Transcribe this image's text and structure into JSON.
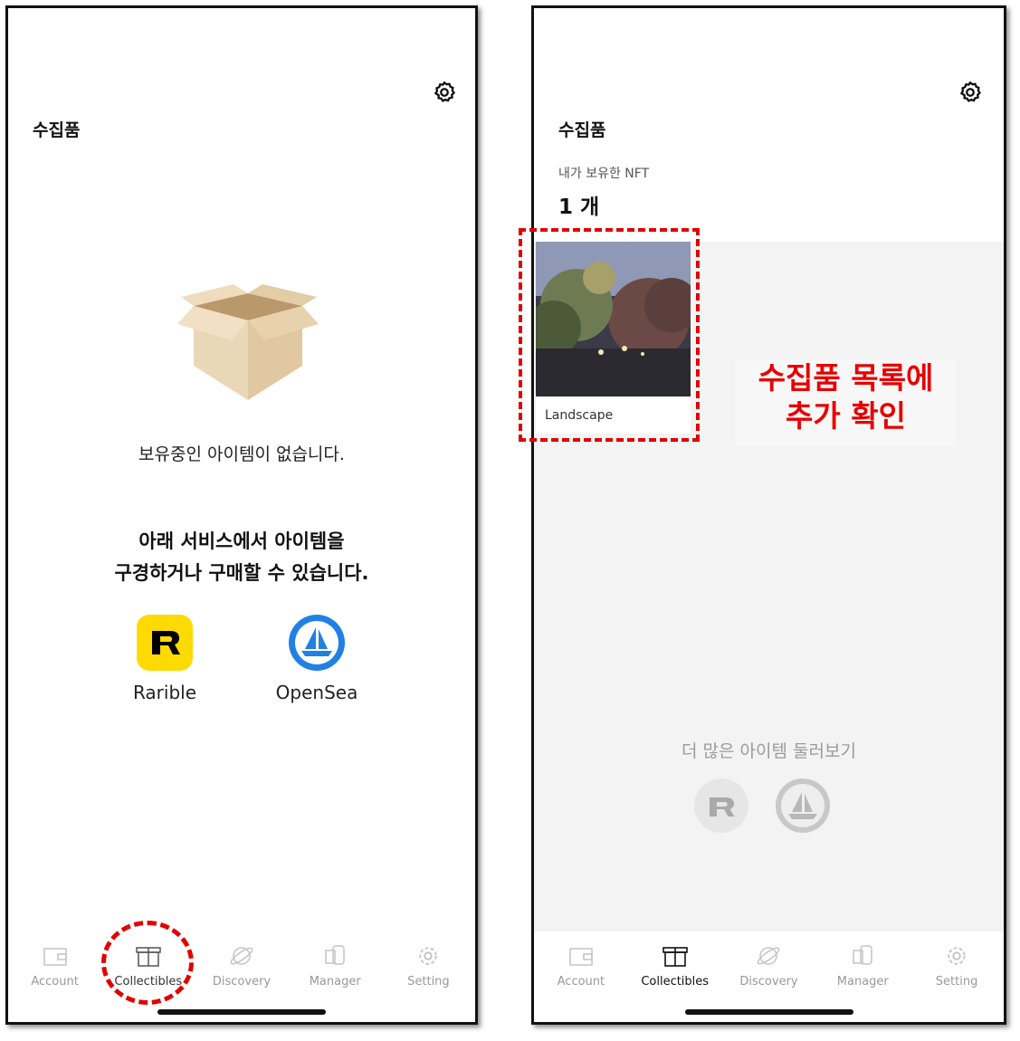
{
  "left_screen": {
    "title": "수집품",
    "empty_message": "보유중인 아이템이 없습니다.",
    "browse_line1": "아래 서비스에서 아이템을",
    "browse_line2": "구경하거나 구매할 수 있습니다.",
    "services": [
      {
        "name": "Rarible",
        "icon": "rarible-logo",
        "color": "#FEDA03"
      },
      {
        "name": "OpenSea",
        "icon": "opensea-logo",
        "color": "#2081E2"
      }
    ]
  },
  "right_screen": {
    "title": "수집품",
    "nft_label": "내가 보유한 NFT",
    "nft_count": "1 개",
    "nfts": [
      {
        "name": "Landscape"
      }
    ],
    "callout_line1": "수집품 목록에",
    "callout_line2": "추가 확인",
    "more_message": "더 많은 아이템 둘러보기"
  },
  "tabs": [
    {
      "label": "Account",
      "icon": "wallet-icon"
    },
    {
      "label": "Collectibles",
      "icon": "gift-box-icon"
    },
    {
      "label": "Discovery",
      "icon": "planet-icon"
    },
    {
      "label": "Manager",
      "icon": "manager-icon"
    },
    {
      "label": "Setting",
      "icon": "gear-icon"
    }
  ],
  "active_tab": "Collectibles",
  "colors": {
    "highlight": "#E10000",
    "inactive_tab": "#999999"
  }
}
